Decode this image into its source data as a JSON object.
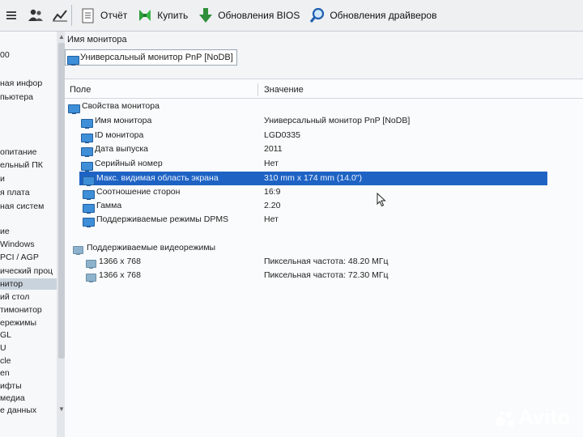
{
  "toolbar": {
    "report_label": "Отчёт",
    "buy_label": "Купить",
    "bios_updates_label": "Обновления BIOS",
    "driver_updates_label": "Обновления драйверов"
  },
  "tree": {
    "items": [
      "00",
      "ная инфор",
      "пьютера",
      "опитание",
      "ельный ПК",
      "и",
      "я плата",
      "ная систем",
      "ие",
      "Windows",
      "PCI / AGP",
      "ический проц",
      "нитор",
      "ий стол",
      "тимонитор",
      "ережимы",
      "GL",
      "U",
      "cle",
      "en",
      "ифты",
      "медиа",
      "е данных"
    ],
    "selected_index": 12
  },
  "device": {
    "label": "Имя монитора",
    "value": "Универсальный монитор PnP [NoDB]"
  },
  "grid": {
    "col_field": "Поле",
    "col_value": "Значение",
    "section1": "Свойства монитора",
    "rows": [
      {
        "field": "Имя монитора",
        "value": "Универсальный монитор PnP [NoDB]"
      },
      {
        "field": "ID монитора",
        "value": "LGD0335"
      },
      {
        "field": "Дата выпуска",
        "value": "2011"
      },
      {
        "field": "Серийный номер",
        "value": "Нет"
      },
      {
        "field": "Макс. видимая область экрана",
        "value": "310 mm x 174 mm (14.0\")"
      },
      {
        "field": "Соотношение сторон",
        "value": "16:9"
      },
      {
        "field": "Гамма",
        "value": "2.20"
      },
      {
        "field": "Поддерживаемые режимы DPMS",
        "value": "Нет"
      }
    ],
    "selected_row": 4,
    "section2": "Поддерживаемые видеорежимы",
    "modes": [
      {
        "field": "1366 x 768",
        "value": "Пиксельная частота: 48.20 МГц"
      },
      {
        "field": "1366 x 768",
        "value": "Пиксельная частота: 72.30 МГц"
      }
    ]
  },
  "watermark": "Avito",
  "colors": {
    "selection": "#1e63c4",
    "monitor_icon": "#3e8fd8"
  }
}
